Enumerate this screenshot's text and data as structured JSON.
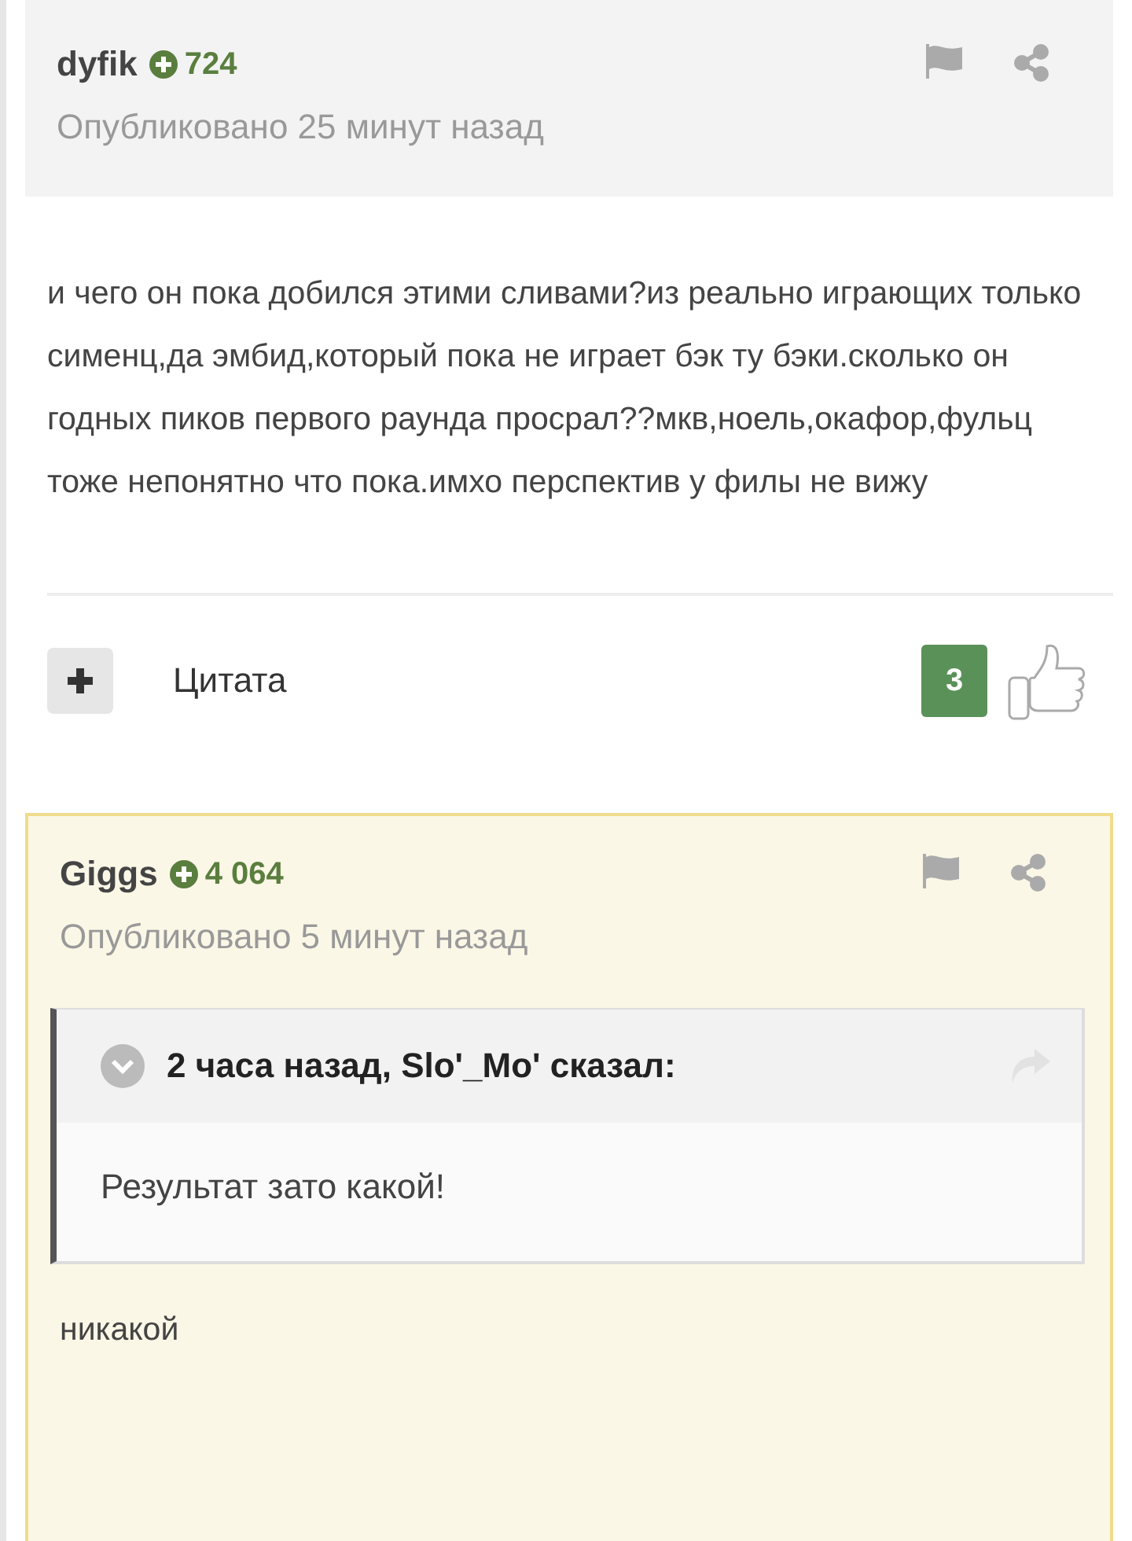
{
  "posts": [
    {
      "author": "dyfik",
      "reputation": "724",
      "published": "Опубликовано 25 минут назад",
      "highlighted": false,
      "body": "и чего он пока добился этими сливами?из реально играющих только сименц,да эмбид,который пока не играет бэк ту бэки.сколько он годных пиков первого раунда просрал??мкв,ноель,окафор,фульц тоже непонятно что пока.имхо перспектив у филы не вижу",
      "footer": {
        "quote_label": "Цитата",
        "likes": "3"
      }
    },
    {
      "author": "Giggs",
      "reputation": "4 064",
      "published": "Опубликовано 5 минут назад",
      "highlighted": true,
      "quote": {
        "citation": "2 часа назад, Slo'_Mo' сказал:",
        "text": "Результат зато какой!"
      },
      "body": "никакой"
    }
  ]
}
